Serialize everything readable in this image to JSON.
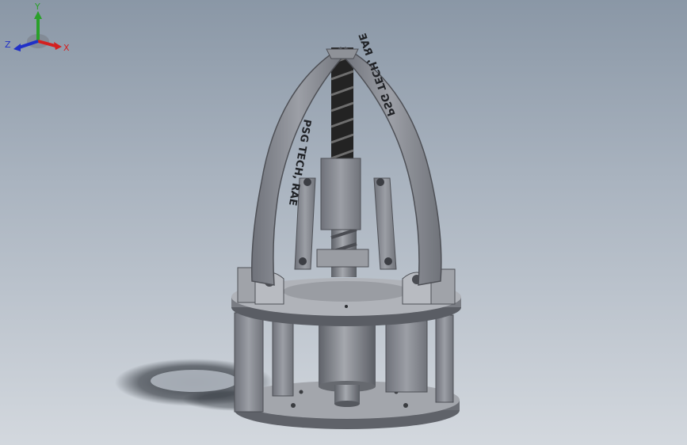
{
  "model": {
    "engraving_left": "PSG TECH, RAE",
    "engraving_right": "PSG TECH, RAE"
  },
  "triad": {
    "x_label": "X",
    "y_label": "Y",
    "z_label": "Z",
    "x_color": "#d42020",
    "y_color": "#2aa02a",
    "z_color": "#2030c8"
  },
  "colors": {
    "body": "#8c8f96",
    "body_dark": "#5f6269",
    "body_light": "#b4b7bd",
    "screw": "#2a2a2a",
    "background_top": "#8a97a6",
    "background_bottom": "#d3d8de"
  }
}
